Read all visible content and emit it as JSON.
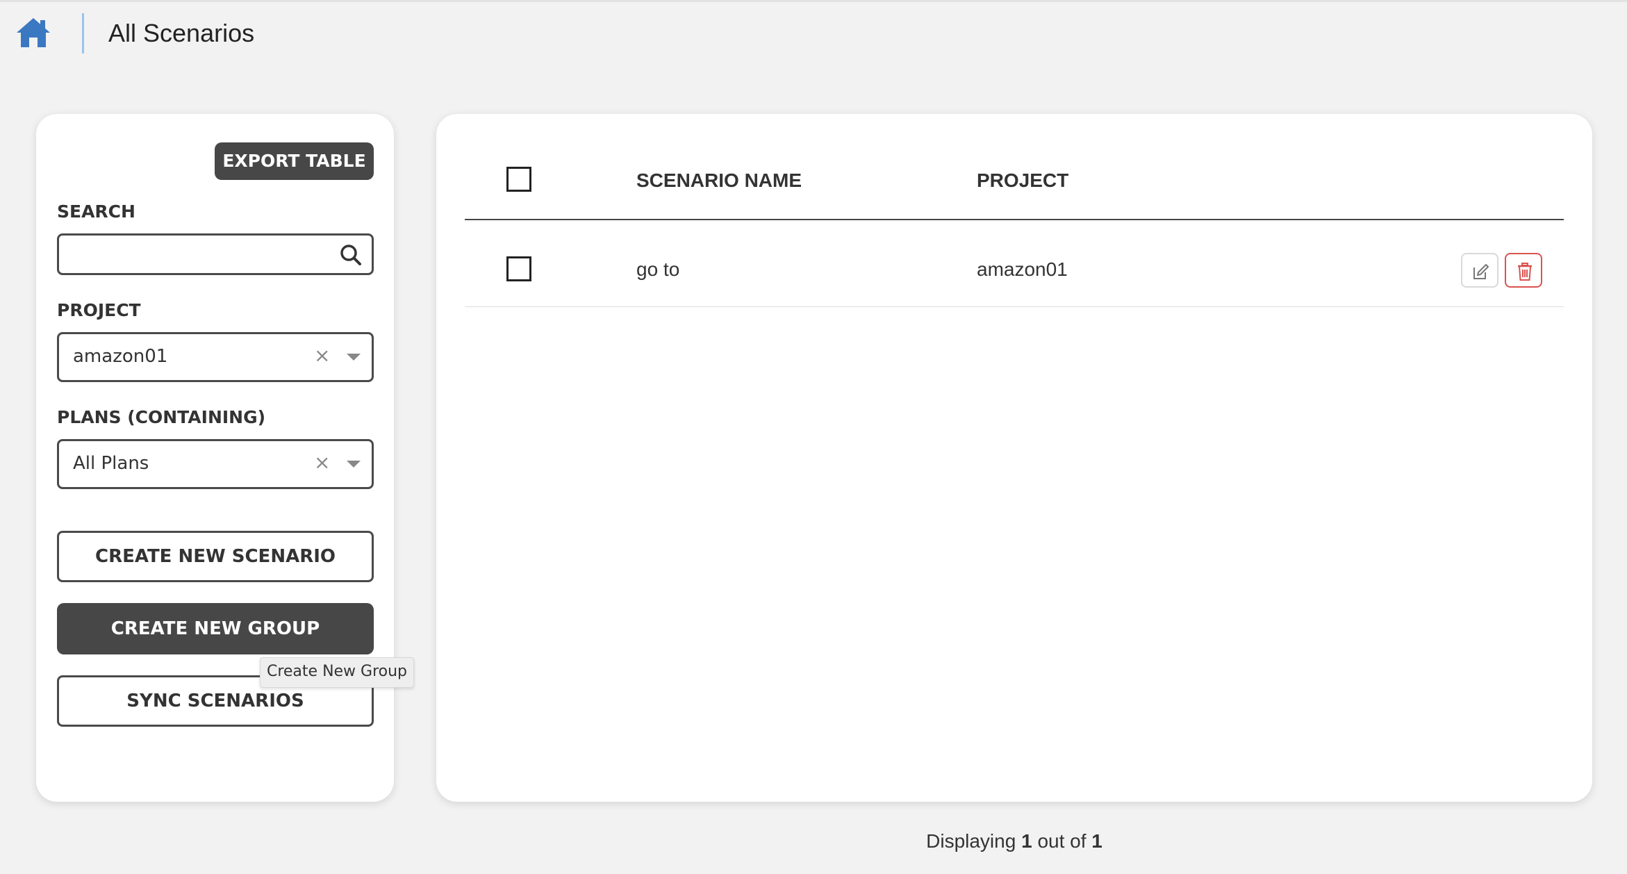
{
  "header": {
    "home_icon": "home-icon",
    "title": "All Scenarios"
  },
  "colors": {
    "home_icon": "#3b78c2",
    "divider": "#9cc4ea",
    "dark_button": "#474747",
    "delete_red": "#d9534f"
  },
  "sidebar": {
    "export_label": "EXPORT TABLE",
    "search_label": "SEARCH",
    "search_value": "",
    "search_icon": "search-icon",
    "project_label": "PROJECT",
    "project_value": "amazon01",
    "plans_label": "PLANS (CONTAINING)",
    "plans_value": "All Plans",
    "clear_glyph": "×",
    "create_scenario_label": "CREATE NEW SCENARIO",
    "create_group_label": "CREATE NEW GROUP",
    "create_group_tooltip": "Create New Group",
    "sync_label": "SYNC SCENARIOS"
  },
  "table": {
    "columns": [
      "SCENARIO NAME",
      "PROJECT"
    ],
    "rows": [
      {
        "name": "go to",
        "project": "amazon01",
        "actions": [
          "edit-icon",
          "delete-icon"
        ]
      }
    ]
  },
  "footer": {
    "prefix": "Displaying",
    "shown": "1",
    "middle": "out of",
    "total": "1"
  }
}
